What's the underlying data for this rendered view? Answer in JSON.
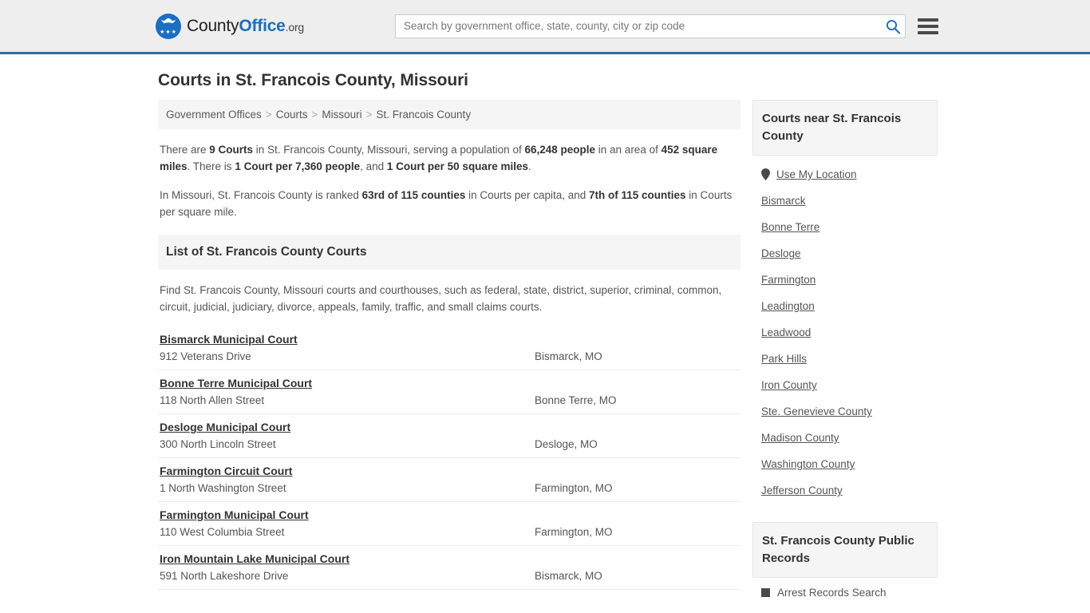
{
  "header": {
    "logo": {
      "part1": "County",
      "part2": "Office",
      "tld": ".org",
      "icon": "eagle-seal-icon"
    },
    "search": {
      "placeholder": "Search by government office, state, county, city or zip code",
      "value": "",
      "search_icon": "search-icon"
    },
    "menu_icon": "hamburger-menu-icon",
    "accent_color": "#1b6ec2",
    "border_color": "#2e6da4"
  },
  "page": {
    "title": "Courts in St. Francois County, Missouri"
  },
  "breadcrumb": {
    "separator": ">",
    "items": [
      {
        "label": "Government Offices"
      },
      {
        "label": "Courts"
      },
      {
        "label": "Missouri"
      },
      {
        "label": "St. Francois County"
      }
    ]
  },
  "intro": {
    "paragraph1": [
      {
        "text": "There are ",
        "bold": false
      },
      {
        "text": "9 Courts",
        "bold": true
      },
      {
        "text": " in St. Francois County, Missouri, serving a population of ",
        "bold": false
      },
      {
        "text": "66,248 people",
        "bold": true
      },
      {
        "text": " in an area of ",
        "bold": false
      },
      {
        "text": "452 square miles",
        "bold": true
      },
      {
        "text": ". There is ",
        "bold": false
      },
      {
        "text": "1 Court per 7,360 people",
        "bold": true
      },
      {
        "text": ", and ",
        "bold": false
      },
      {
        "text": "1 Court per 50 square miles",
        "bold": true
      },
      {
        "text": ".",
        "bold": false
      }
    ],
    "paragraph2": [
      {
        "text": "In Missouri, St. Francois County is ranked ",
        "bold": false
      },
      {
        "text": "63rd of 115 counties",
        "bold": true
      },
      {
        "text": " in Courts per capita, and ",
        "bold": false
      },
      {
        "text": "7th of 115 counties",
        "bold": true
      },
      {
        "text": " in Courts per square mile.",
        "bold": false
      }
    ]
  },
  "list_section": {
    "header": "List of St. Francois County Courts",
    "description": "Find St. Francois County, Missouri courts and courthouses, such as federal, state, district, superior, criminal, common, circuit, judicial, judiciary, divorce, appeals, family, traffic, and small claims courts."
  },
  "courts": [
    {
      "name": "Bismarck Municipal Court",
      "address": "912 Veterans Drive",
      "city": "Bismarck, MO"
    },
    {
      "name": "Bonne Terre Municipal Court",
      "address": "118 North Allen Street",
      "city": "Bonne Terre, MO"
    },
    {
      "name": "Desloge Municipal Court",
      "address": "300 North Lincoln Street",
      "city": "Desloge, MO"
    },
    {
      "name": "Farmington Circuit Court",
      "address": "1 North Washington Street",
      "city": "Farmington, MO"
    },
    {
      "name": "Farmington Municipal Court",
      "address": "110 West Columbia Street",
      "city": "Farmington, MO"
    },
    {
      "name": "Iron Mountain Lake Municipal Court",
      "address": "591 North Lakeshore Drive",
      "city": "Bismarck, MO"
    }
  ],
  "sidebar": {
    "nearby": {
      "title": "Courts near St. Francois County",
      "use_my_location": {
        "label": "Use My Location",
        "icon": "map-pin-icon"
      },
      "links": [
        {
          "label": "Bismarck"
        },
        {
          "label": "Bonne Terre"
        },
        {
          "label": "Desloge"
        },
        {
          "label": "Farmington"
        },
        {
          "label": "Leadington"
        },
        {
          "label": "Leadwood"
        },
        {
          "label": "Park Hills"
        },
        {
          "label": "Iron County"
        },
        {
          "label": "Ste. Genevieve County"
        },
        {
          "label": "Madison County"
        },
        {
          "label": "Washington County"
        },
        {
          "label": "Jefferson County"
        }
      ]
    },
    "records": {
      "title": "St. Francois County Public Records",
      "items": [
        {
          "label": "Arrest Records Search",
          "icon": "square-bullet-icon"
        }
      ]
    }
  }
}
